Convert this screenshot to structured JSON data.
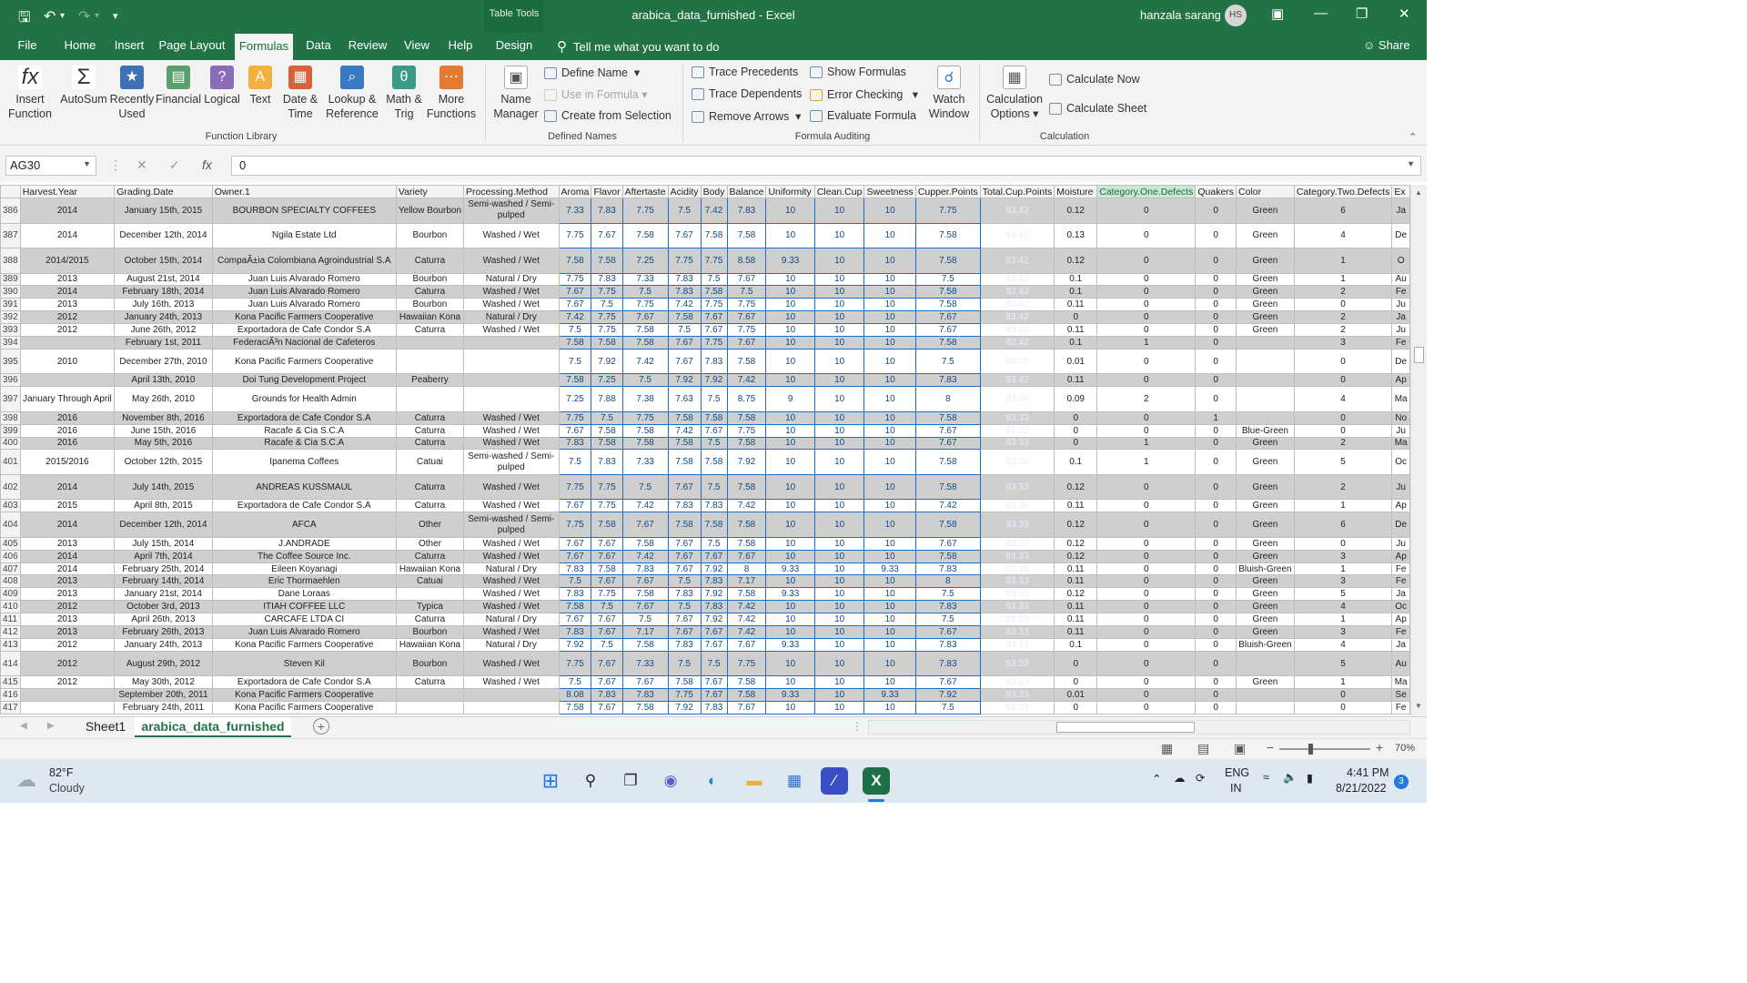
{
  "window": {
    "context_tab": "Table Tools",
    "title": "arabica_data_furnished  -  Excel",
    "user": "hanzala sarang",
    "initials": "HS"
  },
  "menu": [
    "File",
    "Home",
    "Insert",
    "Page Layout",
    "Formulas",
    "Data",
    "Review",
    "View",
    "Help",
    "Design"
  ],
  "tell_me": "Tell me what you want to do",
  "share": "Share",
  "ribbon": {
    "library": [
      {
        "label": "Insert Function",
        "glyph": "fx",
        "color": "#ffffff",
        "text": "#333"
      },
      {
        "label": "AutoSum",
        "glyph": "Σ",
        "color": "#ffffff",
        "text": "#333"
      },
      {
        "label": "Recently Used",
        "glyph": "★",
        "color": "#3f72b5",
        "text": "#fff"
      },
      {
        "label": "Financial",
        "glyph": "▤",
        "color": "#5aa06a",
        "text": "#fff"
      },
      {
        "label": "Logical",
        "glyph": "?",
        "color": "#8e6bb8",
        "text": "#fff"
      },
      {
        "label": "Text",
        "glyph": "A",
        "color": "#f3b23f",
        "text": "#fff"
      },
      {
        "label": "Date & Time",
        "glyph": "▦",
        "color": "#d8603a",
        "text": "#fff"
      },
      {
        "label": "Lookup & Reference",
        "glyph": "⌕",
        "color": "#3a78c2",
        "text": "#fff"
      },
      {
        "label": "Math & Trig",
        "glyph": "θ",
        "color": "#3a9a86",
        "text": "#fff"
      },
      {
        "label": "More Functions",
        "glyph": "⋯",
        "color": "#e37a2f",
        "text": "#fff"
      }
    ],
    "library_group": "Function Library",
    "name_manager": "Name Manager",
    "define_name": "Define Name",
    "use_in_formula": "Use in Formula",
    "create_from_selection": "Create from Selection",
    "defined_group": "Defined Names",
    "trace_precedents": "Trace Precedents",
    "trace_dependents": "Trace Dependents",
    "remove_arrows": "Remove Arrows",
    "show_formulas": "Show Formulas",
    "error_checking": "Error Checking",
    "evaluate_formula": "Evaluate Formula",
    "watch_window": "Watch Window",
    "auditing_group": "Formula Auditing",
    "calculation_options": "Calculation Options",
    "calculate_now": "Calculate Now",
    "calculate_sheet": "Calculate Sheet",
    "calculation_group": "Calculation"
  },
  "name_box": "AG30",
  "formula": "0",
  "columns": [
    "Harvest.Year",
    "Grading.Date",
    "Owner.1",
    "Variety",
    "Processing.Method",
    "Aroma",
    "Flavor",
    "Aftertaste",
    "Acidity",
    "Body",
    "Balance",
    "Uniformity",
    "Clean.Cup",
    "Sweetness",
    "Cupper.Points",
    "Total.Cup.Points",
    "Moisture",
    "Category.One.Defects",
    "Quakers",
    "Color",
    "Category.Two.Defects",
    "Ex"
  ],
  "rows": [
    [
      "386",
      "2014",
      "January 15th, 2015",
      "BOURBON SPECIALTY COFFEES",
      "Yellow Bourbon",
      "Semi-washed / Semi-pulped",
      "7.33",
      "7.83",
      "7.75",
      "7.5",
      "7.42",
      "7.83",
      "10",
      "10",
      "10",
      "7.75",
      "83.42",
      "0.12",
      "0",
      "0",
      "Green",
      "6",
      "Ja"
    ],
    [
      "387",
      "2014",
      "December 12th, 2014",
      "Ngila Estate Ltd",
      "Bourbon",
      "Washed / Wet",
      "7.75",
      "7.67",
      "7.58",
      "7.67",
      "7.58",
      "7.58",
      "10",
      "10",
      "10",
      "7.58",
      "83.42",
      "0.13",
      "0",
      "0",
      "Green",
      "4",
      "De"
    ],
    [
      "388",
      "2014/2015",
      "October 15th, 2014",
      "CompaÃ±ia Colombiana Agroindustrial S.A",
      "Caturra",
      "Washed / Wet",
      "7.58",
      "7.58",
      "7.25",
      "7.75",
      "7.75",
      "8.58",
      "9.33",
      "10",
      "10",
      "7.58",
      "83.42",
      "0.12",
      "0",
      "0",
      "Green",
      "1",
      "O"
    ],
    [
      "389",
      "2013",
      "August 21st, 2014",
      "Juan Luis Alvarado Romero",
      "Bourbon",
      "Natural / Dry",
      "7.75",
      "7.83",
      "7.33",
      "7.83",
      "7.5",
      "7.67",
      "10",
      "10",
      "10",
      "7.5",
      "83.42",
      "0.1",
      "0",
      "0",
      "Green",
      "1",
      "Au"
    ],
    [
      "390",
      "2014",
      "February 18th, 2014",
      "Juan Luis Alvarado Romero",
      "Caturra",
      "Washed / Wet",
      "7.67",
      "7.75",
      "7.5",
      "7.83",
      "7.58",
      "7.5",
      "10",
      "10",
      "10",
      "7.58",
      "83.42",
      "0.1",
      "0",
      "0",
      "Green",
      "2",
      "Fe"
    ],
    [
      "391",
      "2013",
      "July 16th, 2013",
      "Juan Luis Alvarado Romero",
      "Bourbon",
      "Washed / Wet",
      "7.67",
      "7.5",
      "7.75",
      "7.42",
      "7.75",
      "7.75",
      "10",
      "10",
      "10",
      "7.58",
      "83.42",
      "0.11",
      "0",
      "0",
      "Green",
      "0",
      "Ju"
    ],
    [
      "392",
      "2012",
      "January 24th, 2013",
      "Kona Pacific Farmers Cooperative",
      "Hawaiian Kona",
      "Natural / Dry",
      "7.42",
      "7.75",
      "7.67",
      "7.58",
      "7.67",
      "7.67",
      "10",
      "10",
      "10",
      "7.67",
      "83.42",
      "0",
      "0",
      "0",
      "Green",
      "2",
      "Ja"
    ],
    [
      "393",
      "2012",
      "June 26th, 2012",
      "Exportadora de Cafe Condor S.A",
      "Caturra",
      "Washed / Wet",
      "7.5",
      "7.75",
      "7.58",
      "7.5",
      "7.67",
      "7.75",
      "10",
      "10",
      "10",
      "7.67",
      "83.42",
      "0.11",
      "0",
      "0",
      "Green",
      "2",
      "Ju"
    ],
    [
      "394",
      "",
      "February 1st, 2011",
      "FederaciÃ³n Nacional de Cafeteros",
      "",
      "",
      "7.58",
      "7.58",
      "7.58",
      "7.67",
      "7.75",
      "7.67",
      "10",
      "10",
      "10",
      "7.58",
      "83.42",
      "0.1",
      "1",
      "0",
      "",
      "3",
      "Fe"
    ],
    [
      "395",
      "2010",
      "December 27th, 2010",
      "Kona Pacific Farmers Cooperative",
      "",
      "",
      "7.5",
      "7.92",
      "7.42",
      "7.67",
      "7.83",
      "7.58",
      "10",
      "10",
      "10",
      "7.5",
      "83.42",
      "0.01",
      "0",
      "0",
      "",
      "0",
      "De"
    ],
    [
      "396",
      "",
      "April 13th, 2010",
      "Doi Tung Development Project",
      "Peaberry",
      "",
      "7.58",
      "7.25",
      "7.5",
      "7.92",
      "7.92",
      "7.42",
      "10",
      "10",
      "10",
      "7.83",
      "83.42",
      "0.11",
      "0",
      "0",
      "",
      "0",
      "Ap"
    ],
    [
      "397",
      "January Through April",
      "May 26th, 2010",
      "Grounds for Health Admin",
      "",
      "",
      "7.25",
      "7.88",
      "7.38",
      "7.63",
      "7.5",
      "8.75",
      "9",
      "10",
      "10",
      "8",
      "83.38",
      "0.09",
      "2",
      "0",
      "",
      "4",
      "Ma"
    ],
    [
      "398",
      "2016",
      "November 8th, 2016",
      "Exportadora de Cafe Condor S.A",
      "Caturra",
      "Washed / Wet",
      "7.75",
      "7.5",
      "7.75",
      "7.58",
      "7.58",
      "7.58",
      "10",
      "10",
      "10",
      "7.58",
      "83.33",
      "0",
      "0",
      "1",
      "",
      "0",
      "No"
    ],
    [
      "399",
      "2016",
      "June 15th, 2016",
      "Racafe & Cia S.C.A",
      "Caturra",
      "Washed / Wet",
      "7.67",
      "7.58",
      "7.58",
      "7.42",
      "7.67",
      "7.75",
      "10",
      "10",
      "10",
      "7.67",
      "83.33",
      "0",
      "0",
      "0",
      "Blue-Green",
      "0",
      "Ju"
    ],
    [
      "400",
      "2016",
      "May 5th, 2016",
      "Racafe & Cia S.C.A",
      "Caturra",
      "Washed / Wet",
      "7.83",
      "7.58",
      "7.58",
      "7.58",
      "7.5",
      "7.58",
      "10",
      "10",
      "10",
      "7.67",
      "83.33",
      "0",
      "1",
      "0",
      "Green",
      "2",
      "Ma"
    ],
    [
      "401",
      "2015/2016",
      "October 12th, 2015",
      "Ipanema Coffees",
      "Catuai",
      "Semi-washed / Semi-pulped",
      "7.5",
      "7.83",
      "7.33",
      "7.58",
      "7.58",
      "7.92",
      "10",
      "10",
      "10",
      "7.58",
      "83.33",
      "0.1",
      "1",
      "0",
      "Green",
      "5",
      "Oc"
    ],
    [
      "402",
      "2014",
      "July 14th, 2015",
      "ANDREAS KUSSMAUL",
      "Caturra",
      "Washed / Wet",
      "7.75",
      "7.75",
      "7.5",
      "7.67",
      "7.5",
      "7.58",
      "10",
      "10",
      "10",
      "7.58",
      "83.33",
      "0.12",
      "0",
      "0",
      "Green",
      "2",
      "Ju"
    ],
    [
      "403",
      "2015",
      "April 8th, 2015",
      "Exportadora de Cafe Condor S.A",
      "Caturra",
      "Washed / Wet",
      "7.67",
      "7.75",
      "7.42",
      "7.83",
      "7.83",
      "7.42",
      "10",
      "10",
      "10",
      "7.42",
      "83.33",
      "0.11",
      "0",
      "0",
      "Green",
      "1",
      "Ap"
    ],
    [
      "404",
      "2014",
      "December 12th, 2014",
      "AFCA",
      "Other",
      "Semi-washed / Semi-pulped",
      "7.75",
      "7.58",
      "7.67",
      "7.58",
      "7.58",
      "7.58",
      "10",
      "10",
      "10",
      "7.58",
      "83.33",
      "0.12",
      "0",
      "0",
      "Green",
      "6",
      "De"
    ],
    [
      "405",
      "2013",
      "July 15th, 2014",
      "J.ANDRADE",
      "Other",
      "Washed / Wet",
      "7.67",
      "7.67",
      "7.58",
      "7.67",
      "7.5",
      "7.58",
      "10",
      "10",
      "10",
      "7.67",
      "83.33",
      "0.12",
      "0",
      "0",
      "Green",
      "0",
      "Ju"
    ],
    [
      "406",
      "2014",
      "April 7th, 2014",
      "The Coffee Source Inc.",
      "Caturra",
      "Washed / Wet",
      "7.67",
      "7.67",
      "7.42",
      "7.67",
      "7.67",
      "7.67",
      "10",
      "10",
      "10",
      "7.58",
      "83.33",
      "0.12",
      "0",
      "0",
      "Green",
      "3",
      "Ap"
    ],
    [
      "407",
      "2014",
      "February 25th, 2014",
      "Eileen Koyanagi",
      "Hawaiian Kona",
      "Natural / Dry",
      "7.83",
      "7.58",
      "7.83",
      "7.67",
      "7.92",
      "8",
      "9.33",
      "10",
      "9.33",
      "7.83",
      "83.33",
      "0.11",
      "0",
      "0",
      "Bluish-Green",
      "1",
      "Fe"
    ],
    [
      "408",
      "2013",
      "February 14th, 2014",
      "Eric Thormaehlen",
      "Catuai",
      "Washed / Wet",
      "7.5",
      "7.67",
      "7.67",
      "7.5",
      "7.83",
      "7.17",
      "10",
      "10",
      "10",
      "8",
      "83.33",
      "0.11",
      "0",
      "0",
      "Green",
      "3",
      "Fe"
    ],
    [
      "409",
      "2013",
      "January 21st, 2014",
      "Dane Loraas",
      "",
      "Washed / Wet",
      "7.83",
      "7.75",
      "7.58",
      "7.83",
      "7.92",
      "7.58",
      "9.33",
      "10",
      "10",
      "7.5",
      "83.33",
      "0.12",
      "0",
      "0",
      "Green",
      "5",
      "Ja"
    ],
    [
      "410",
      "2012",
      "October 3rd, 2013",
      "ITIAH COFFEE LLC",
      "Typica",
      "Washed / Wet",
      "7.58",
      "7.5",
      "7.67",
      "7.5",
      "7.83",
      "7.42",
      "10",
      "10",
      "10",
      "7.83",
      "83.33",
      "0.11",
      "0",
      "0",
      "Green",
      "4",
      "Oc"
    ],
    [
      "411",
      "2013",
      "April 26th, 2013",
      "CARCAFE LTDA CI",
      "Caturra",
      "Natural / Dry",
      "7.67",
      "7.67",
      "7.5",
      "7.67",
      "7.92",
      "7.42",
      "10",
      "10",
      "10",
      "7.5",
      "83.33",
      "0.11",
      "0",
      "0",
      "Green",
      "1",
      "Ap"
    ],
    [
      "412",
      "2013",
      "February 26th, 2013",
      "Juan Luis Alvarado Romero",
      "Bourbon",
      "Washed / Wet",
      "7.83",
      "7.67",
      "7.17",
      "7.67",
      "7.67",
      "7.42",
      "10",
      "10",
      "10",
      "7.67",
      "83.33",
      "0.11",
      "0",
      "0",
      "Green",
      "3",
      "Fe"
    ],
    [
      "413",
      "2012",
      "January 24th, 2013",
      "Kona Pacific Farmers Cooperative",
      "Hawaiian Kona",
      "Natural / Dry",
      "7.92",
      "7.5",
      "7.58",
      "7.83",
      "7.67",
      "7.67",
      "9.33",
      "10",
      "10",
      "7.83",
      "83.33",
      "0.1",
      "0",
      "0",
      "Bluish-Green",
      "4",
      "Ja"
    ],
    [
      "414",
      "2012",
      "August 29th, 2012",
      "Steven Kil",
      "Bourbon",
      "Washed / Wet",
      "7.75",
      "7.67",
      "7.33",
      "7.5",
      "7.5",
      "7.75",
      "10",
      "10",
      "10",
      "7.83",
      "83.33",
      "0",
      "0",
      "0",
      "",
      "5",
      "Au"
    ],
    [
      "415",
      "2012",
      "May 30th, 2012",
      "Exportadora de Cafe Condor S.A",
      "Caturra",
      "Washed / Wet",
      "7.5",
      "7.67",
      "7.67",
      "7.58",
      "7.67",
      "7.58",
      "10",
      "10",
      "10",
      "7.67",
      "83.33",
      "0",
      "0",
      "0",
      "Green",
      "1",
      "Ma"
    ],
    [
      "416",
      "",
      "September 20th, 2011",
      "Kona Pacific Farmers Cooperative",
      "",
      "",
      "8.08",
      "7.83",
      "7.83",
      "7.75",
      "7.67",
      "7.58",
      "9.33",
      "10",
      "9.33",
      "7.92",
      "83.33",
      "0.01",
      "0",
      "0",
      "",
      "0",
      "Se"
    ],
    [
      "417",
      "",
      "February 24th, 2011",
      "Kona Pacific Farmers Cooperative",
      "",
      "",
      "7.58",
      "7.67",
      "7.58",
      "7.92",
      "7.83",
      "7.67",
      "10",
      "10",
      "10",
      "7.5",
      "83.33",
      "0",
      "0",
      "0",
      "",
      "0",
      "Fe"
    ]
  ],
  "sheets": [
    "Sheet1",
    "arabica_data_furnished"
  ],
  "status": {
    "zoom": "70%"
  },
  "taskbar": {
    "temp": "82°F",
    "weather": "Cloudy",
    "lang1": "ENG",
    "lang2": "IN",
    "time": "4:41 PM",
    "date": "8/21/2022",
    "badge": "3"
  }
}
